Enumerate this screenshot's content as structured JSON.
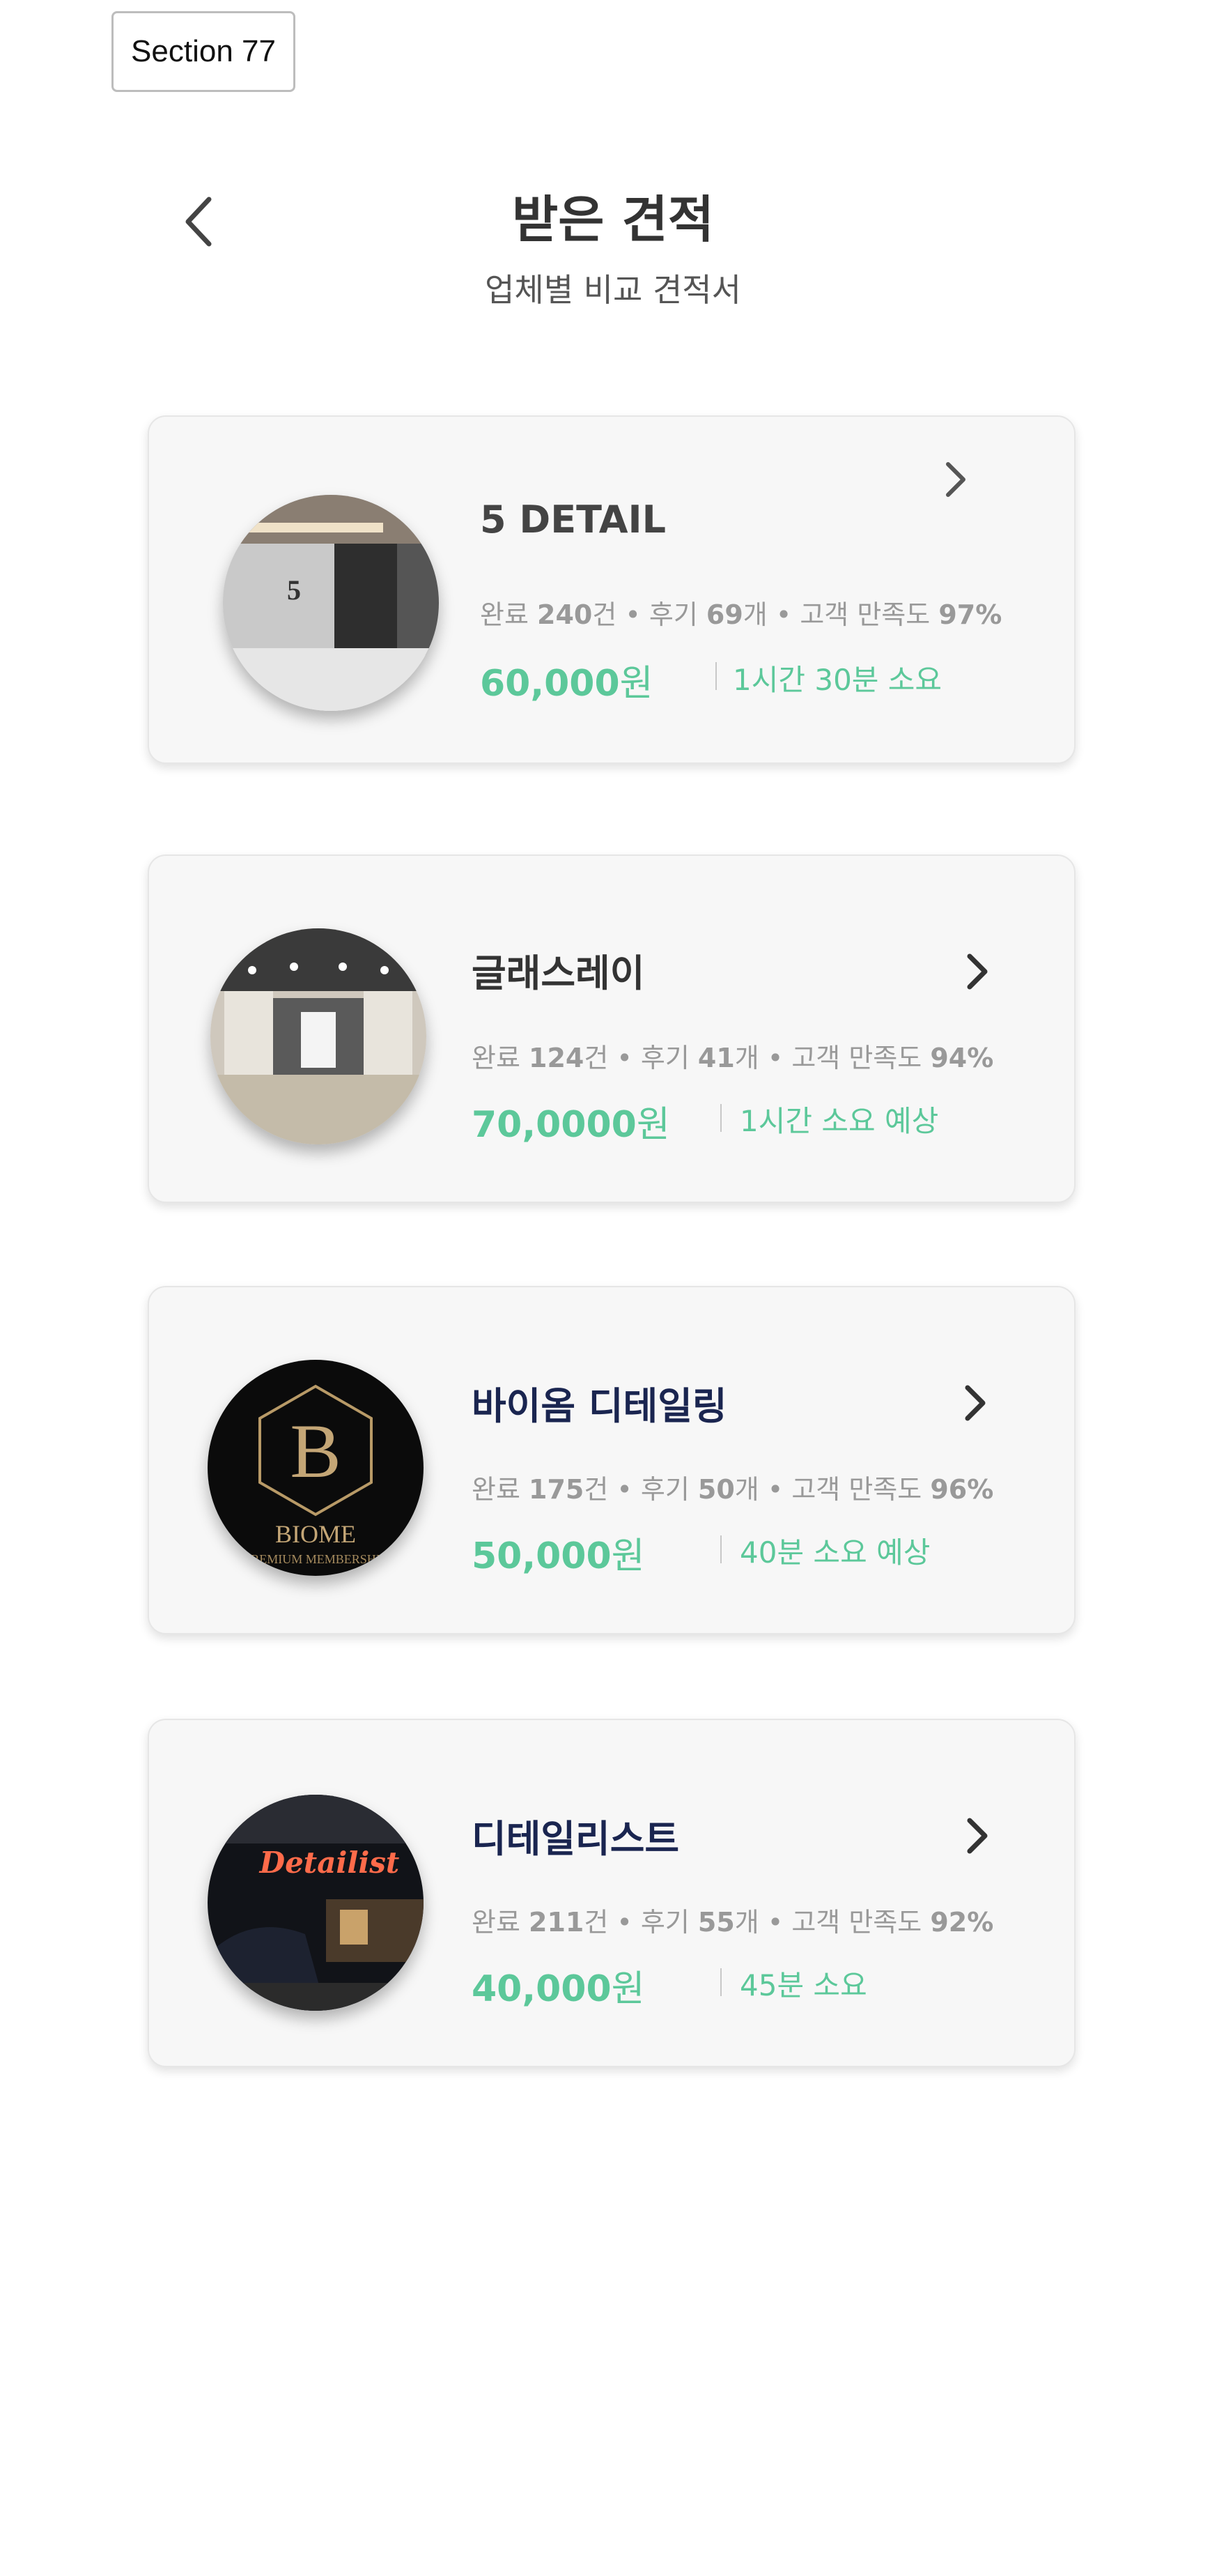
{
  "section_label": "Section 77",
  "header": {
    "title": "받은 견적",
    "subtitle": "업체별 비교 견적서"
  },
  "colors": {
    "accent_green": "#5cc89a",
    "name_dark": "#444444",
    "name_navy": "#1a2550",
    "stats_gray": "#999999"
  },
  "icons": {
    "back": "chevron-left-icon",
    "detail": "chevron-right-icon"
  },
  "quotes": [
    {
      "name": "5 DETAIL",
      "completed_label": "완료",
      "completed_num": "240",
      "completed_unit": "건",
      "reviews_label": "후기",
      "reviews_num": "69",
      "reviews_unit": "개",
      "satisfaction_label": "고객 만족도",
      "satisfaction_num": "97",
      "satisfaction_unit": "%",
      "price_num": "60,000",
      "price_unit": "원",
      "duration": "1시간 30분 소요"
    },
    {
      "name": "글래스레이",
      "completed_label": "완료",
      "completed_num": "124",
      "completed_unit": "건",
      "reviews_label": "후기",
      "reviews_num": "41",
      "reviews_unit": "개",
      "satisfaction_label": "고객 만족도",
      "satisfaction_num": "94",
      "satisfaction_unit": "%",
      "price_num": "70,0000",
      "price_unit": "원",
      "duration": "1시간 소요 예상"
    },
    {
      "name": "바이옴 디테일링",
      "logo_letter": "B",
      "logo_text": "BIOME",
      "logo_subtext": "PREMIUM MEMBERSHIP",
      "completed_label": "완료",
      "completed_num": "175",
      "completed_unit": "건",
      "reviews_label": "후기",
      "reviews_num": "50",
      "reviews_unit": "개",
      "satisfaction_label": "고객 만족도",
      "satisfaction_num": "96",
      "satisfaction_unit": "%",
      "price_num": "50,000",
      "price_unit": "원",
      "duration": "40분 소요 예상"
    },
    {
      "name": "디테일리스트",
      "logo_sign": "Detailist",
      "completed_label": "완료",
      "completed_num": "211",
      "completed_unit": "건",
      "reviews_label": "후기",
      "reviews_num": "55",
      "reviews_unit": "개",
      "satisfaction_label": "고객 만족도",
      "satisfaction_num": "92",
      "satisfaction_unit": "%",
      "price_num": "40,000",
      "price_unit": "원",
      "duration": "45분 소요"
    }
  ]
}
